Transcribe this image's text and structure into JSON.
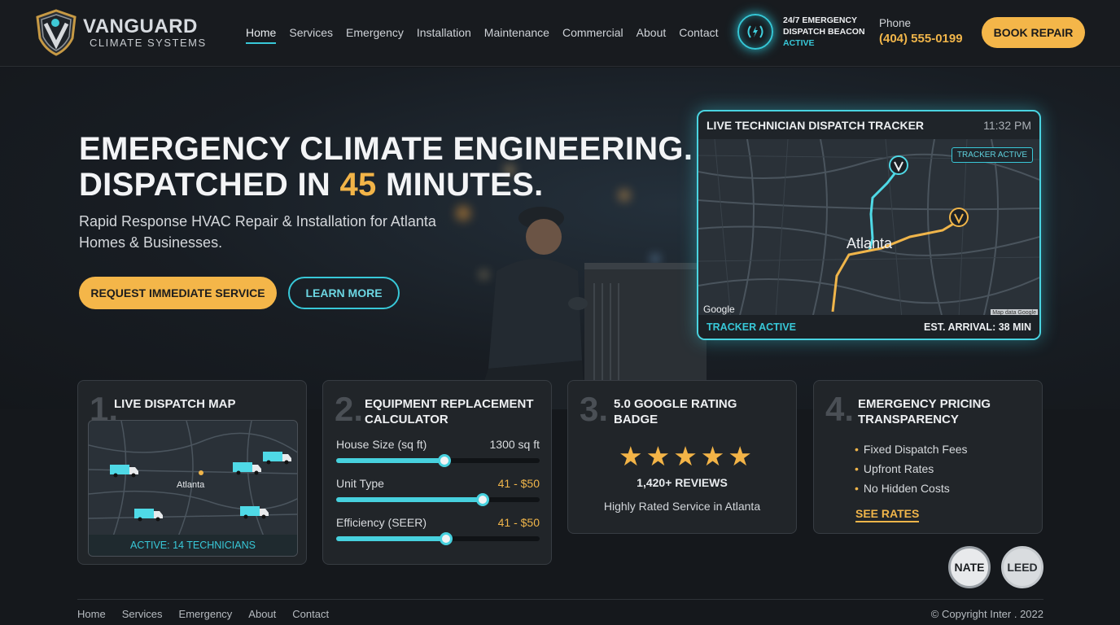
{
  "brand": {
    "name": "VANGUARD",
    "tagline": "CLIMATE SYSTEMS"
  },
  "nav": [
    "Home",
    "Services",
    "Emergency",
    "Installation",
    "Maintenance",
    "Commercial",
    "About",
    "Contact"
  ],
  "nav_active": "Home",
  "beacon": {
    "line1": "24/7 EMERGENCY",
    "line2": "DISPATCH BEACON",
    "status": "ACTIVE"
  },
  "phone": {
    "label": "Phone",
    "number": "(404) 555-0199"
  },
  "header_cta": "BOOK REPAIR",
  "hero": {
    "title_line1": "EMERGENCY CLIMATE ENGINEERING.",
    "title_line2_pre": "DISPATCHED IN ",
    "title_line2_accent": "45",
    "title_line2_post": " MINUTES.",
    "subtitle": "Rapid Response HVAC Repair & Installation for Atlanta Homes & Businesses.",
    "primary_cta": "REQUEST IMMEDIATE SERVICE",
    "secondary_cta": "LEARN MORE"
  },
  "tracker": {
    "title": "LIVE TECHNICIAN DISPATCH TRACKER",
    "time": "11:32 PM",
    "badge": "TRACKER ACTIVE",
    "city": "Atlanta",
    "map_brand": "Google",
    "map_credit": "Map data Google",
    "footer_left": "TRACKER ACTIVE",
    "footer_right": "EST. ARRIVAL: 38 MIN"
  },
  "cards": {
    "map": {
      "num": "1.",
      "title": "LIVE DISPATCH MAP",
      "city": "Atlanta",
      "footer": "ACTIVE: 14 TECHNICIANS"
    },
    "calculator": {
      "num": "2.",
      "title_line1": "EQUIPMENT REPLACEMENT",
      "title_line2": "CALCULATOR",
      "sliders": [
        {
          "label": "House Size (sq ft)",
          "value": "1300 sq ft",
          "level": 0.53
        },
        {
          "label": "Unit Type",
          "value": "41 - $50",
          "level": 0.72
        },
        {
          "label": "Efficiency (SEER)",
          "value": "41 - $50",
          "level": 0.54
        }
      ]
    },
    "rating": {
      "num": "3.",
      "title_line1": "5.0 GOOGLE RATING",
      "title_line2": "BADGE",
      "stars": 5,
      "reviews": "1,420+ REVIEWS",
      "sub": "Highly Rated Service in Atlanta"
    },
    "pricing": {
      "num": "4.",
      "title_line1": "EMERGENCY PRICING",
      "title_line2": "TRANSPARENCY",
      "bullets": [
        "Fixed Dispatch Fees",
        "Upfront Rates",
        "No Hidden Costs"
      ],
      "link": "SEE RATES"
    }
  },
  "certs": [
    "NATE",
    "LEED"
  ],
  "footer": {
    "links": [
      "Home",
      "Services",
      "Emergency",
      "About",
      "Contact"
    ],
    "copyright": "© Copyright Inter . 2022"
  },
  "colors": {
    "accent_gold": "#f4b649",
    "accent_cyan": "#38c8d8",
    "background": "#15181c"
  }
}
